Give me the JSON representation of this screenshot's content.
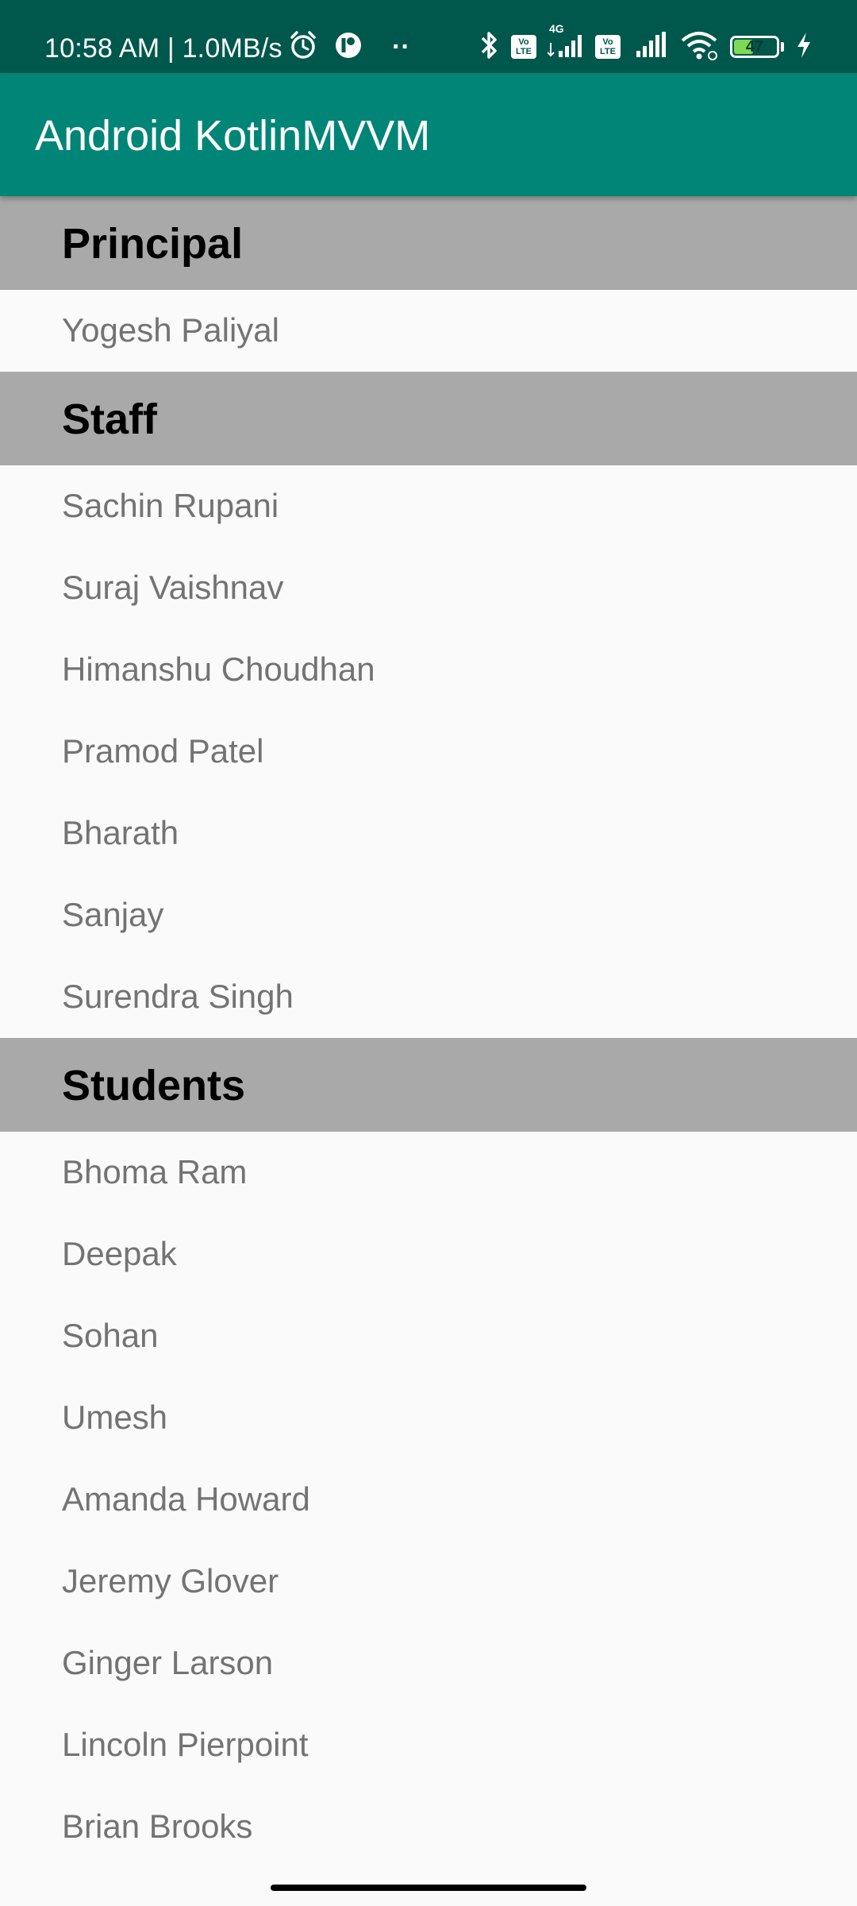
{
  "status_bar": {
    "time": "10:58 AM | 1.0MB/s",
    "dots": "··",
    "volte1": [
      "Vo",
      "LTE"
    ],
    "network_type": "4G",
    "volte2": [
      "Vo",
      "LTE"
    ],
    "battery_level": "47",
    "battery_fraction": 0.47,
    "icons": [
      "alarm-icon",
      "app-notification-icon",
      "bluetooth-icon",
      "volte-icon",
      "signal-icon",
      "volte-icon",
      "signal-icon",
      "wifi-icon",
      "battery-icon",
      "charging-icon"
    ],
    "colors": {
      "background": "#00574b",
      "battery_fill": "#7ed957"
    }
  },
  "app_bar": {
    "title": "Android KotlinMVVM",
    "color": "#008577"
  },
  "sections": [
    {
      "title": "Principal",
      "items": [
        "Yogesh Paliyal"
      ]
    },
    {
      "title": "Staff",
      "items": [
        "Sachin Rupani",
        "Suraj Vaishnav",
        "Himanshu Choudhan",
        "Pramod Patel",
        "Bharath",
        "Sanjay",
        "Surendra Singh"
      ]
    },
    {
      "title": "Students",
      "items": [
        "Bhoma Ram",
        "Deepak",
        "Sohan",
        "Umesh",
        "Amanda Howard",
        "Jeremy Glover",
        "Ginger Larson",
        "Lincoln Pierpoint",
        "Brian Brooks"
      ]
    }
  ],
  "colors": {
    "section_header": "#a9a9a9",
    "list_background": "#fafafa",
    "item_text": "#737373"
  }
}
